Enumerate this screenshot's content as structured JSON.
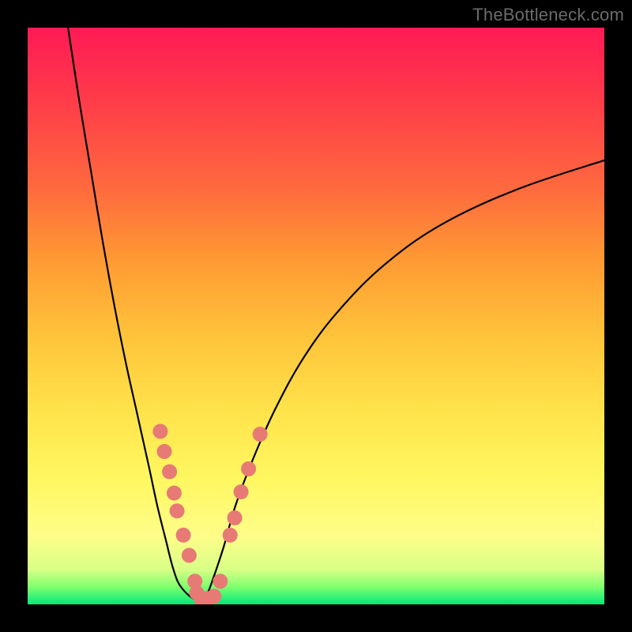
{
  "watermark": "TheBottleneck.com",
  "colors": {
    "frame": "#000000",
    "curve": "#000000",
    "dot_fill": "#e77a75",
    "dot_stroke": "#d86b66"
  },
  "chart_data": {
    "type": "line",
    "title": "",
    "xlabel": "",
    "ylabel": "",
    "xlim": [
      0,
      100
    ],
    "ylim": [
      0,
      100
    ],
    "grid": false,
    "legend": false,
    "series": [
      {
        "name": "left-curve",
        "x": [
          7,
          9,
          11,
          13,
          15,
          17,
          19,
          21,
          22.5,
          24,
          25,
          26,
          27,
          28,
          29,
          30
        ],
        "y": [
          100,
          87,
          75,
          63,
          52,
          42,
          33,
          24,
          17,
          11,
          7,
          4,
          2.5,
          1.5,
          0.8,
          0.4
        ]
      },
      {
        "name": "right-curve",
        "x": [
          30,
          31,
          32,
          34,
          36,
          39,
          43,
          48,
          54,
          62,
          72,
          85,
          100
        ],
        "y": [
          0.4,
          1.5,
          4,
          10,
          17,
          25,
          34,
          43,
          51,
          59,
          66,
          72,
          77
        ]
      }
    ],
    "dots": [
      {
        "x": 23.0,
        "y": 30.0
      },
      {
        "x": 23.7,
        "y": 26.5
      },
      {
        "x": 24.6,
        "y": 23.0
      },
      {
        "x": 25.4,
        "y": 19.3
      },
      {
        "x": 25.9,
        "y": 16.2
      },
      {
        "x": 27.0,
        "y": 12.0
      },
      {
        "x": 28.0,
        "y": 8.5
      },
      {
        "x": 29.0,
        "y": 4.0
      },
      {
        "x": 29.3,
        "y": 2.0
      },
      {
        "x": 30.0,
        "y": 1.0
      },
      {
        "x": 31.0,
        "y": 1.0
      },
      {
        "x": 32.3,
        "y": 1.4
      },
      {
        "x": 33.4,
        "y": 4.0
      },
      {
        "x": 35.1,
        "y": 12.0
      },
      {
        "x": 35.9,
        "y": 15.0
      },
      {
        "x": 37.0,
        "y": 19.5
      },
      {
        "x": 38.3,
        "y": 23.5
      },
      {
        "x": 40.3,
        "y": 29.5
      }
    ]
  }
}
